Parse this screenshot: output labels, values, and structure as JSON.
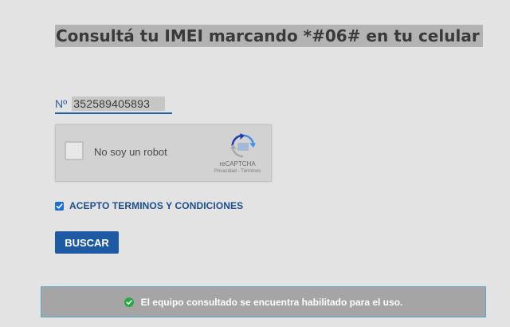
{
  "page": {
    "title": "Consultá tu IMEI marcando *#06# en tu celular"
  },
  "imei_field": {
    "prefix": "Nº",
    "value": "352589405893"
  },
  "recaptcha": {
    "label": "No soy un robot",
    "brand": "reCAPTCHA",
    "links": "Privacidad - Términos",
    "checked": false,
    "icon": "recaptcha-logo-icon"
  },
  "terms": {
    "label": "ACEPTO TERMINOS Y CONDICIONES",
    "checked": true
  },
  "search_button": {
    "label": "BUSCAR"
  },
  "result_alert": {
    "message": "El equipo consultado se encuentra habilitado para el uso.",
    "icon": "check-circle-icon"
  },
  "colors": {
    "background": "#e3e3e3",
    "accent_blue": "#1e5aa3",
    "checkbox_blue": "#1a6fd0",
    "success_green": "#27a844",
    "alert_background": "#a5a5a5"
  }
}
